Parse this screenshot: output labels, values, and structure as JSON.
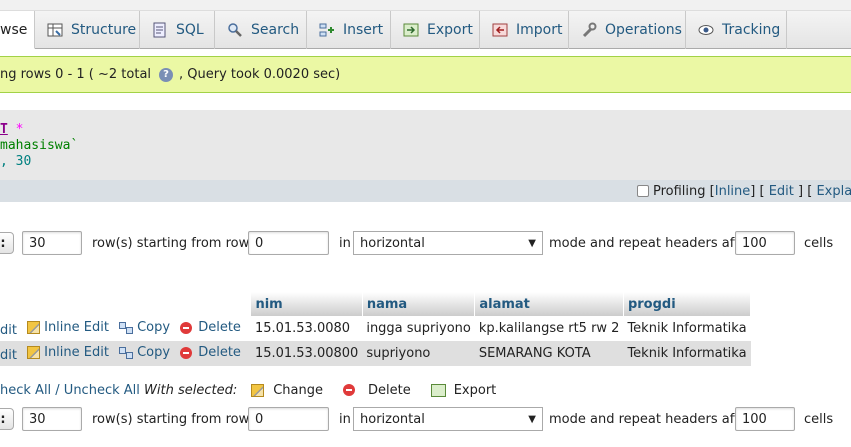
{
  "tabs": [
    {
      "label": "wse",
      "icon": "browse-icon",
      "active": true
    },
    {
      "label": "Structure",
      "icon": "structure-icon"
    },
    {
      "label": "SQL",
      "icon": "sql-icon"
    },
    {
      "label": "Search",
      "icon": "search-icon"
    },
    {
      "label": "Insert",
      "icon": "insert-icon"
    },
    {
      "label": "Export",
      "icon": "export-icon"
    },
    {
      "label": "Import",
      "icon": "import-icon"
    },
    {
      "label": "Operations",
      "icon": "wrench-icon"
    },
    {
      "label": "Tracking",
      "icon": "eye-icon"
    }
  ],
  "notice": {
    "prefix": "ng rows 0 - 1 ( ~2 total",
    "suffix": ", Query took 0.0020 sec)"
  },
  "sql": {
    "line1_keyword": "T",
    "line1_star": " *",
    "line2": "mahasiswa`",
    "line3": ", 30"
  },
  "profiling": {
    "label": "Profiling",
    "inline": "Inline",
    "edit": "Edit",
    "explain": "Explain S"
  },
  "nav": {
    "rows": "30",
    "rows_label": "row(s) starting from row #",
    "start": "0",
    "in_label": "in",
    "mode": "horizontal",
    "mode_label": "mode and repeat headers after",
    "headers": "100",
    "cells_label": "cells"
  },
  "table": {
    "columns": [
      "nim",
      "nama",
      "alamat",
      "progdi"
    ],
    "actions": {
      "edit": "dit",
      "inline_edit": "Inline Edit",
      "copy": "Copy",
      "delete": "Delete"
    },
    "rows": [
      {
        "nim": "15.01.53.0080",
        "nama": "ingga supriyono",
        "alamat": "kp.kalilangse rt5 rw 2",
        "progdi": "Teknik Informatika"
      },
      {
        "nim": "15.01.53.00800",
        "nama": "supriyono",
        "alamat": "SEMARANG KOTA",
        "progdi": "Teknik Informatika"
      }
    ]
  },
  "with_selected": {
    "check_all": "heck All / Uncheck All",
    "label": "With selected:",
    "change": "Change",
    "delete": "Delete",
    "export": "Export"
  }
}
